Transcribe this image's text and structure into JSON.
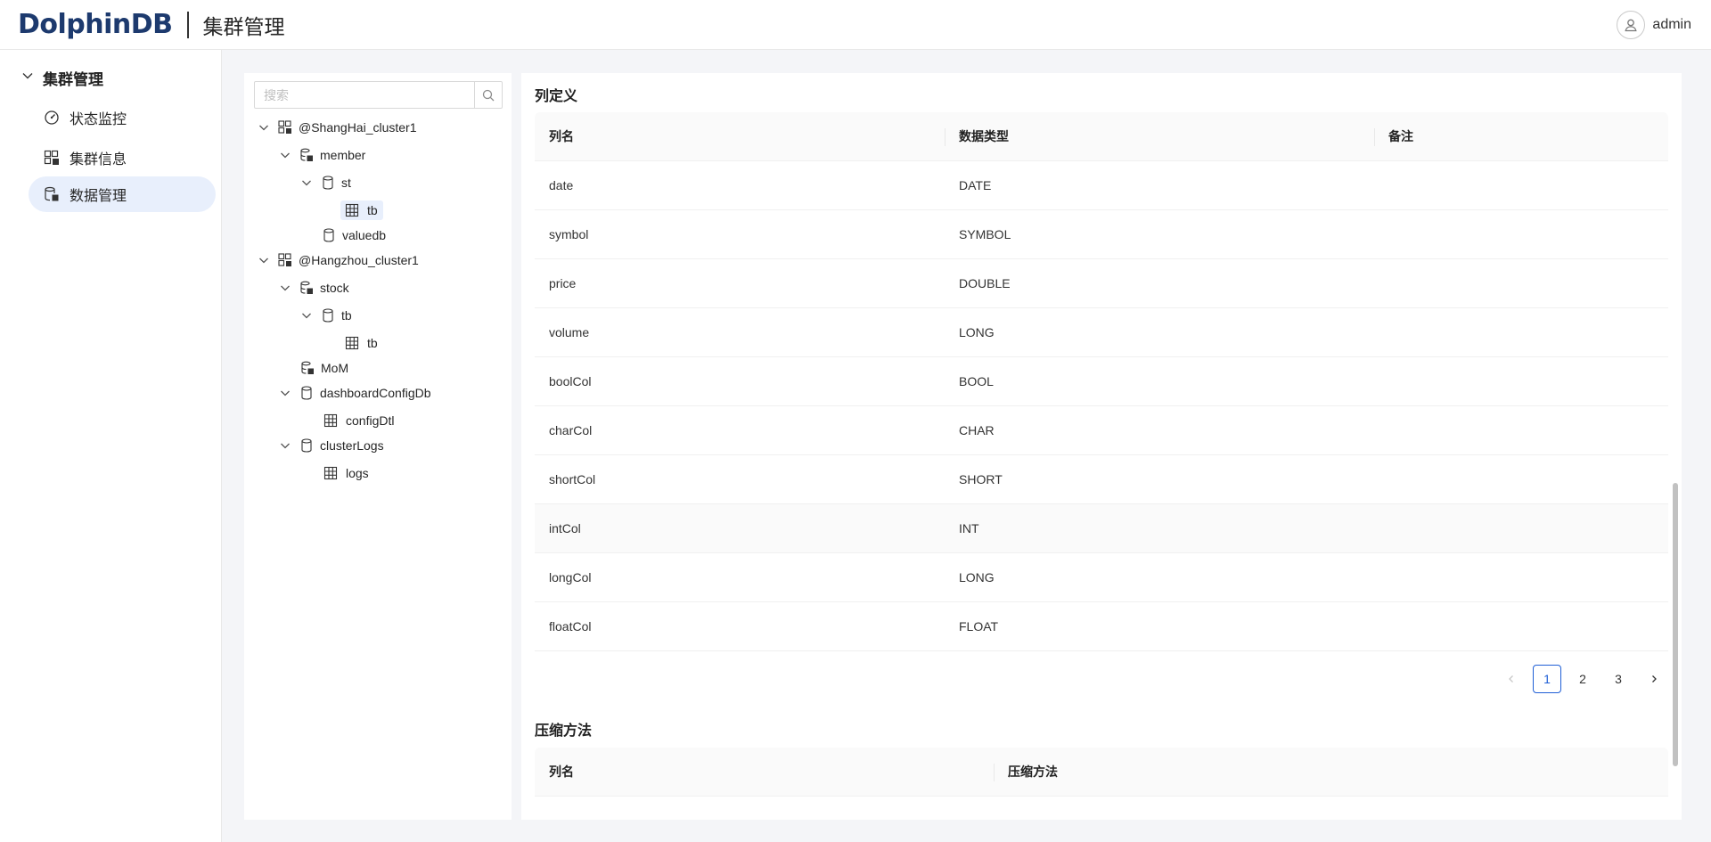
{
  "header": {
    "logo_text": "DolphinDB",
    "title": "集群管理",
    "username": "admin",
    "colors": {
      "brand": "#1d3a6e",
      "accent": "#1f5fd6"
    }
  },
  "sidebar": {
    "group_label": "集群管理",
    "items": [
      {
        "label": "状态监控",
        "icon": "gauge-icon",
        "active": false
      },
      {
        "label": "集群信息",
        "icon": "cluster-icon",
        "active": false
      },
      {
        "label": "数据管理",
        "icon": "database-icon",
        "active": true
      }
    ]
  },
  "tree": {
    "search_placeholder": "搜索",
    "nodes": [
      {
        "label": "@ShangHai_cluster1",
        "icon": "cluster-icon",
        "expanded": true
      },
      {
        "label": "member",
        "icon": "node-icon",
        "expanded": true
      },
      {
        "label": "st",
        "icon": "database-icon",
        "expanded": true
      },
      {
        "label": "tb",
        "icon": "table-icon",
        "selected": true
      },
      {
        "label": "valuedb",
        "icon": "database-icon"
      },
      {
        "label": "@Hangzhou_cluster1",
        "icon": "cluster-icon",
        "expanded": true
      },
      {
        "label": "stock",
        "icon": "node-icon",
        "expanded": true
      },
      {
        "label": "tb",
        "icon": "database-icon",
        "expanded": true
      },
      {
        "label": "tb",
        "icon": "table-icon"
      },
      {
        "label": "MoM",
        "icon": "node-icon"
      },
      {
        "label": "dashboardConfigDb",
        "icon": "database-icon",
        "expanded": true
      },
      {
        "label": "configDtl",
        "icon": "table-icon"
      },
      {
        "label": "clusterLogs",
        "icon": "database-icon",
        "expanded": true
      },
      {
        "label": "logs",
        "icon": "table-icon"
      }
    ]
  },
  "columns_section": {
    "title": "列定义",
    "headers": [
      "列名",
      "数据类型",
      "备注"
    ],
    "rows": [
      {
        "name": "date",
        "type": "DATE",
        "note": ""
      },
      {
        "name": "symbol",
        "type": "SYMBOL",
        "note": ""
      },
      {
        "name": "price",
        "type": "DOUBLE",
        "note": ""
      },
      {
        "name": "volume",
        "type": "LONG",
        "note": ""
      },
      {
        "name": "boolCol",
        "type": "BOOL",
        "note": ""
      },
      {
        "name": "charCol",
        "type": "CHAR",
        "note": ""
      },
      {
        "name": "shortCol",
        "type": "SHORT",
        "note": ""
      },
      {
        "name": "intCol",
        "type": "INT",
        "note": ""
      },
      {
        "name": "longCol",
        "type": "LONG",
        "note": ""
      },
      {
        "name": "floatCol",
        "type": "FLOAT",
        "note": ""
      }
    ],
    "pagination": {
      "pages": [
        "1",
        "2",
        "3"
      ],
      "current": "1"
    }
  },
  "compression_section": {
    "title": "压缩方法",
    "headers": [
      "列名",
      "压缩方法"
    ]
  }
}
